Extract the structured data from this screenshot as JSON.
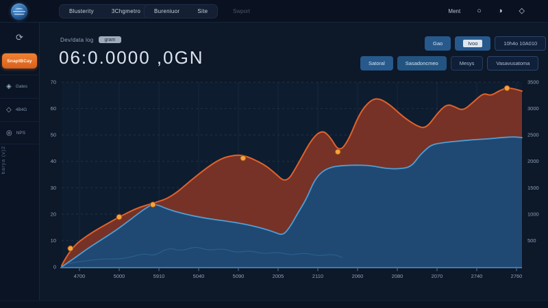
{
  "topnav": {
    "items": [
      "Blusterity",
      "3Chgmetro",
      "Bureniuor",
      "Site"
    ],
    "faint_item": "Swport",
    "right_label": "Ment"
  },
  "icons": {
    "refresh": "⟳",
    "circle": "○",
    "half_moon": "◑",
    "diamond": "◇",
    "diamond_filled": "◈",
    "target": "◎"
  },
  "sidebar": {
    "active_label": "SnaptBCay",
    "items": [
      {
        "label": "Gates"
      },
      {
        "label": "4B4G"
      },
      {
        "label": "NPS"
      }
    ],
    "vertical_label": "barya (v)2"
  },
  "header": {
    "title": "Dev/data log",
    "badge": "gram",
    "value": "06:0.0000 ,0GN"
  },
  "toolbar": {
    "row1": [
      {
        "label": "Gao"
      },
      {
        "label": "Ivoo"
      },
      {
        "label": "10h4o 10A010"
      }
    ],
    "row2": [
      {
        "label": "Satoral"
      },
      {
        "label": "Sasadoncmeo"
      },
      {
        "label": "Mesys"
      },
      {
        "label": "Vasavusatoma"
      }
    ]
  },
  "colors": {
    "accent_orange": "#e8732a",
    "red_fill": "#7b3327",
    "red_line": "#e2622b",
    "blue_fill": "#1c4a76",
    "blue_line": "#4da0d8",
    "marker": "#f7a23f",
    "grid": "#263850",
    "axis_text": "#8ea2ba",
    "baseline": "#4678a8"
  },
  "chart_data": {
    "type": "area",
    "title": "",
    "xlabel": "",
    "ylabel": "",
    "x_range": [
      0,
      12
    ],
    "y_range": [
      0,
      70
    ],
    "grid": true,
    "legend": "none",
    "x_ticks": [
      "4700",
      "5000",
      "5910",
      "5040",
      "5090",
      "2005",
      "2110",
      "2060",
      "2080",
      "2070",
      "2740",
      "2760"
    ],
    "y_left_ticks": [
      "70",
      "60",
      "50",
      "40",
      "30",
      "20",
      "10",
      "0"
    ],
    "y_right_ticks": [
      "3500",
      "3000",
      "2500",
      "2000",
      "1500",
      "1000",
      "500"
    ],
    "series": [
      {
        "name": "primary-red-area",
        "points": [
          [
            0,
            0.5
          ],
          [
            0.23,
            7
          ],
          [
            0.71,
            12.4
          ],
          [
            1.25,
            16.9
          ],
          [
            1.5,
            18.9
          ],
          [
            1.96,
            22.3
          ],
          [
            2.38,
            24.1
          ],
          [
            2.86,
            26.4
          ],
          [
            3.48,
            34.2
          ],
          [
            4.11,
            41
          ],
          [
            4.55,
            42.5
          ],
          [
            4.82,
            42
          ],
          [
            5.27,
            38.9
          ],
          [
            5.54,
            35.8
          ],
          [
            5.86,
            31.6
          ],
          [
            6.16,
            38.9
          ],
          [
            6.52,
            48.5
          ],
          [
            6.79,
            51.9
          ],
          [
            7,
            49.3
          ],
          [
            7.23,
            43.6
          ],
          [
            7.46,
            47.4
          ],
          [
            7.77,
            58.3
          ],
          [
            8.04,
            63
          ],
          [
            8.25,
            64
          ],
          [
            8.54,
            61.7
          ],
          [
            8.89,
            57
          ],
          [
            9.25,
            53.4
          ],
          [
            9.5,
            52.4
          ],
          [
            9.79,
            58.1
          ],
          [
            10.04,
            61.7
          ],
          [
            10.25,
            60.7
          ],
          [
            10.46,
            59.1
          ],
          [
            10.75,
            62.7
          ],
          [
            11,
            65.9
          ],
          [
            11.18,
            64.8
          ],
          [
            11.39,
            66.6
          ],
          [
            11.61,
            67.9
          ],
          [
            11.82,
            67.4
          ],
          [
            12,
            66.6
          ]
        ]
      },
      {
        "name": "secondary-blue-area",
        "points": [
          [
            0,
            0
          ],
          [
            0.36,
            3.6
          ],
          [
            0.71,
            7.3
          ],
          [
            1.07,
            10.6
          ],
          [
            1.43,
            14
          ],
          [
            1.79,
            17.9
          ],
          [
            2.14,
            21.8
          ],
          [
            2.41,
            24.1
          ],
          [
            2.77,
            21.8
          ],
          [
            3.21,
            20
          ],
          [
            3.75,
            18.4
          ],
          [
            4.29,
            17.4
          ],
          [
            4.82,
            16.1
          ],
          [
            5.27,
            14.5
          ],
          [
            5.54,
            13.2
          ],
          [
            5.77,
            11.9
          ],
          [
            5.96,
            15.3
          ],
          [
            6.14,
            20
          ],
          [
            6.38,
            25.7
          ],
          [
            6.59,
            32.9
          ],
          [
            6.8,
            36.3
          ],
          [
            7.04,
            37.9
          ],
          [
            7.32,
            38.4
          ],
          [
            7.68,
            38.6
          ],
          [
            8.07,
            38.4
          ],
          [
            8.43,
            37.3
          ],
          [
            8.79,
            37.1
          ],
          [
            9.11,
            37.9
          ],
          [
            9.32,
            42
          ],
          [
            9.5,
            44.6
          ],
          [
            9.66,
            46.4
          ],
          [
            10,
            47.2
          ],
          [
            10.36,
            47.7
          ],
          [
            10.75,
            48.2
          ],
          [
            11.11,
            48.5
          ],
          [
            11.46,
            49
          ],
          [
            11.79,
            49.3
          ],
          [
            12,
            49
          ]
        ]
      },
      {
        "name": "faint-baseline-trace",
        "points": [
          [
            0.18,
            1.3
          ],
          [
            0.89,
            3.1
          ],
          [
            1.61,
            2.9
          ],
          [
            2.14,
            5.2
          ],
          [
            2.41,
            4.1
          ],
          [
            2.77,
            7.3
          ],
          [
            3.13,
            6
          ],
          [
            3.48,
            7.8
          ],
          [
            3.84,
            6.2
          ],
          [
            4.2,
            7
          ],
          [
            4.55,
            5.4
          ],
          [
            4.91,
            6.2
          ],
          [
            5.27,
            4.9
          ],
          [
            5.63,
            5.7
          ],
          [
            5.98,
            4.4
          ],
          [
            6.34,
            5.4
          ],
          [
            6.7,
            4.1
          ],
          [
            7.05,
            4.9
          ],
          [
            7.32,
            3.6
          ]
        ]
      }
    ],
    "markers": [
      [
        0.23,
        7
      ],
      [
        1.5,
        18.9
      ],
      [
        2.38,
        23.6
      ],
      [
        4.73,
        41.2
      ],
      [
        7.2,
        43.6
      ],
      [
        11.61,
        67.7
      ]
    ]
  }
}
